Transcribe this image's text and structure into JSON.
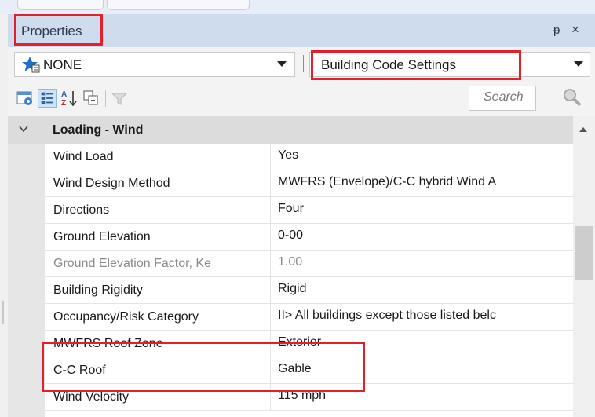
{
  "panel": {
    "title": "Properties",
    "pin_glyph": "ᵽ",
    "close_glyph": "×"
  },
  "selector": {
    "left_value": "NONE",
    "left_icon": "star-icon",
    "right_value": "Building Code Settings"
  },
  "toolbar": {
    "search_placeholder": "Search",
    "icons": [
      "property-pages-icon",
      "categorized-icon",
      "sort-alphabetical-icon",
      "expand-all-icon",
      "filter-icon",
      "search-icon"
    ]
  },
  "grid": {
    "category": "Loading - Wind",
    "rows": [
      {
        "label": "Wind Load",
        "value": "Yes",
        "readonly": false
      },
      {
        "label": "Wind Design Method",
        "value": "MWFRS (Envelope)/C-C hybrid Wind A",
        "readonly": false
      },
      {
        "label": "Directions",
        "value": "Four",
        "readonly": false
      },
      {
        "label": "Ground Elevation",
        "value": "0-00",
        "readonly": false
      },
      {
        "label": "Ground Elevation Factor, Ke",
        "value": "1.00",
        "readonly": true
      },
      {
        "label": "Building Rigidity",
        "value": "Rigid",
        "readonly": false
      },
      {
        "label": "Occupancy/Risk Category",
        "value": "II> All buildings except those listed belc",
        "readonly": false
      },
      {
        "label": "MWFRS Roof Zone",
        "value": "Exterior",
        "readonly": false
      },
      {
        "label": "C-C Roof",
        "value": "Gable",
        "readonly": false
      },
      {
        "label": "Wind Velocity",
        "value": "115 mph",
        "readonly": false
      }
    ]
  },
  "colors": {
    "highlight": "#e0202a",
    "titlebar": "#cfdcee"
  }
}
